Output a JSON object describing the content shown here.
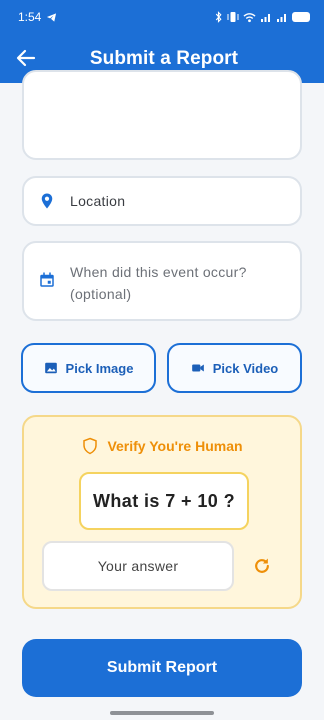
{
  "status": {
    "time": "1:54"
  },
  "appbar": {
    "title": "Submit a Report"
  },
  "form": {
    "location_placeholder": "Location",
    "date_placeholder_line1": "When did this event occur?",
    "date_placeholder_line2": "(optional)",
    "pick_image_label": "Pick Image",
    "pick_video_label": "Pick Video"
  },
  "captcha": {
    "title": "Verify You're Human",
    "question": "What is 7 + 10 ?",
    "answer_placeholder": "Your answer"
  },
  "submit_label": "Submit Report",
  "colors": {
    "primary": "#1c6fd6",
    "warning": "#ee8f08",
    "warning_bg": "#fff6dc"
  }
}
